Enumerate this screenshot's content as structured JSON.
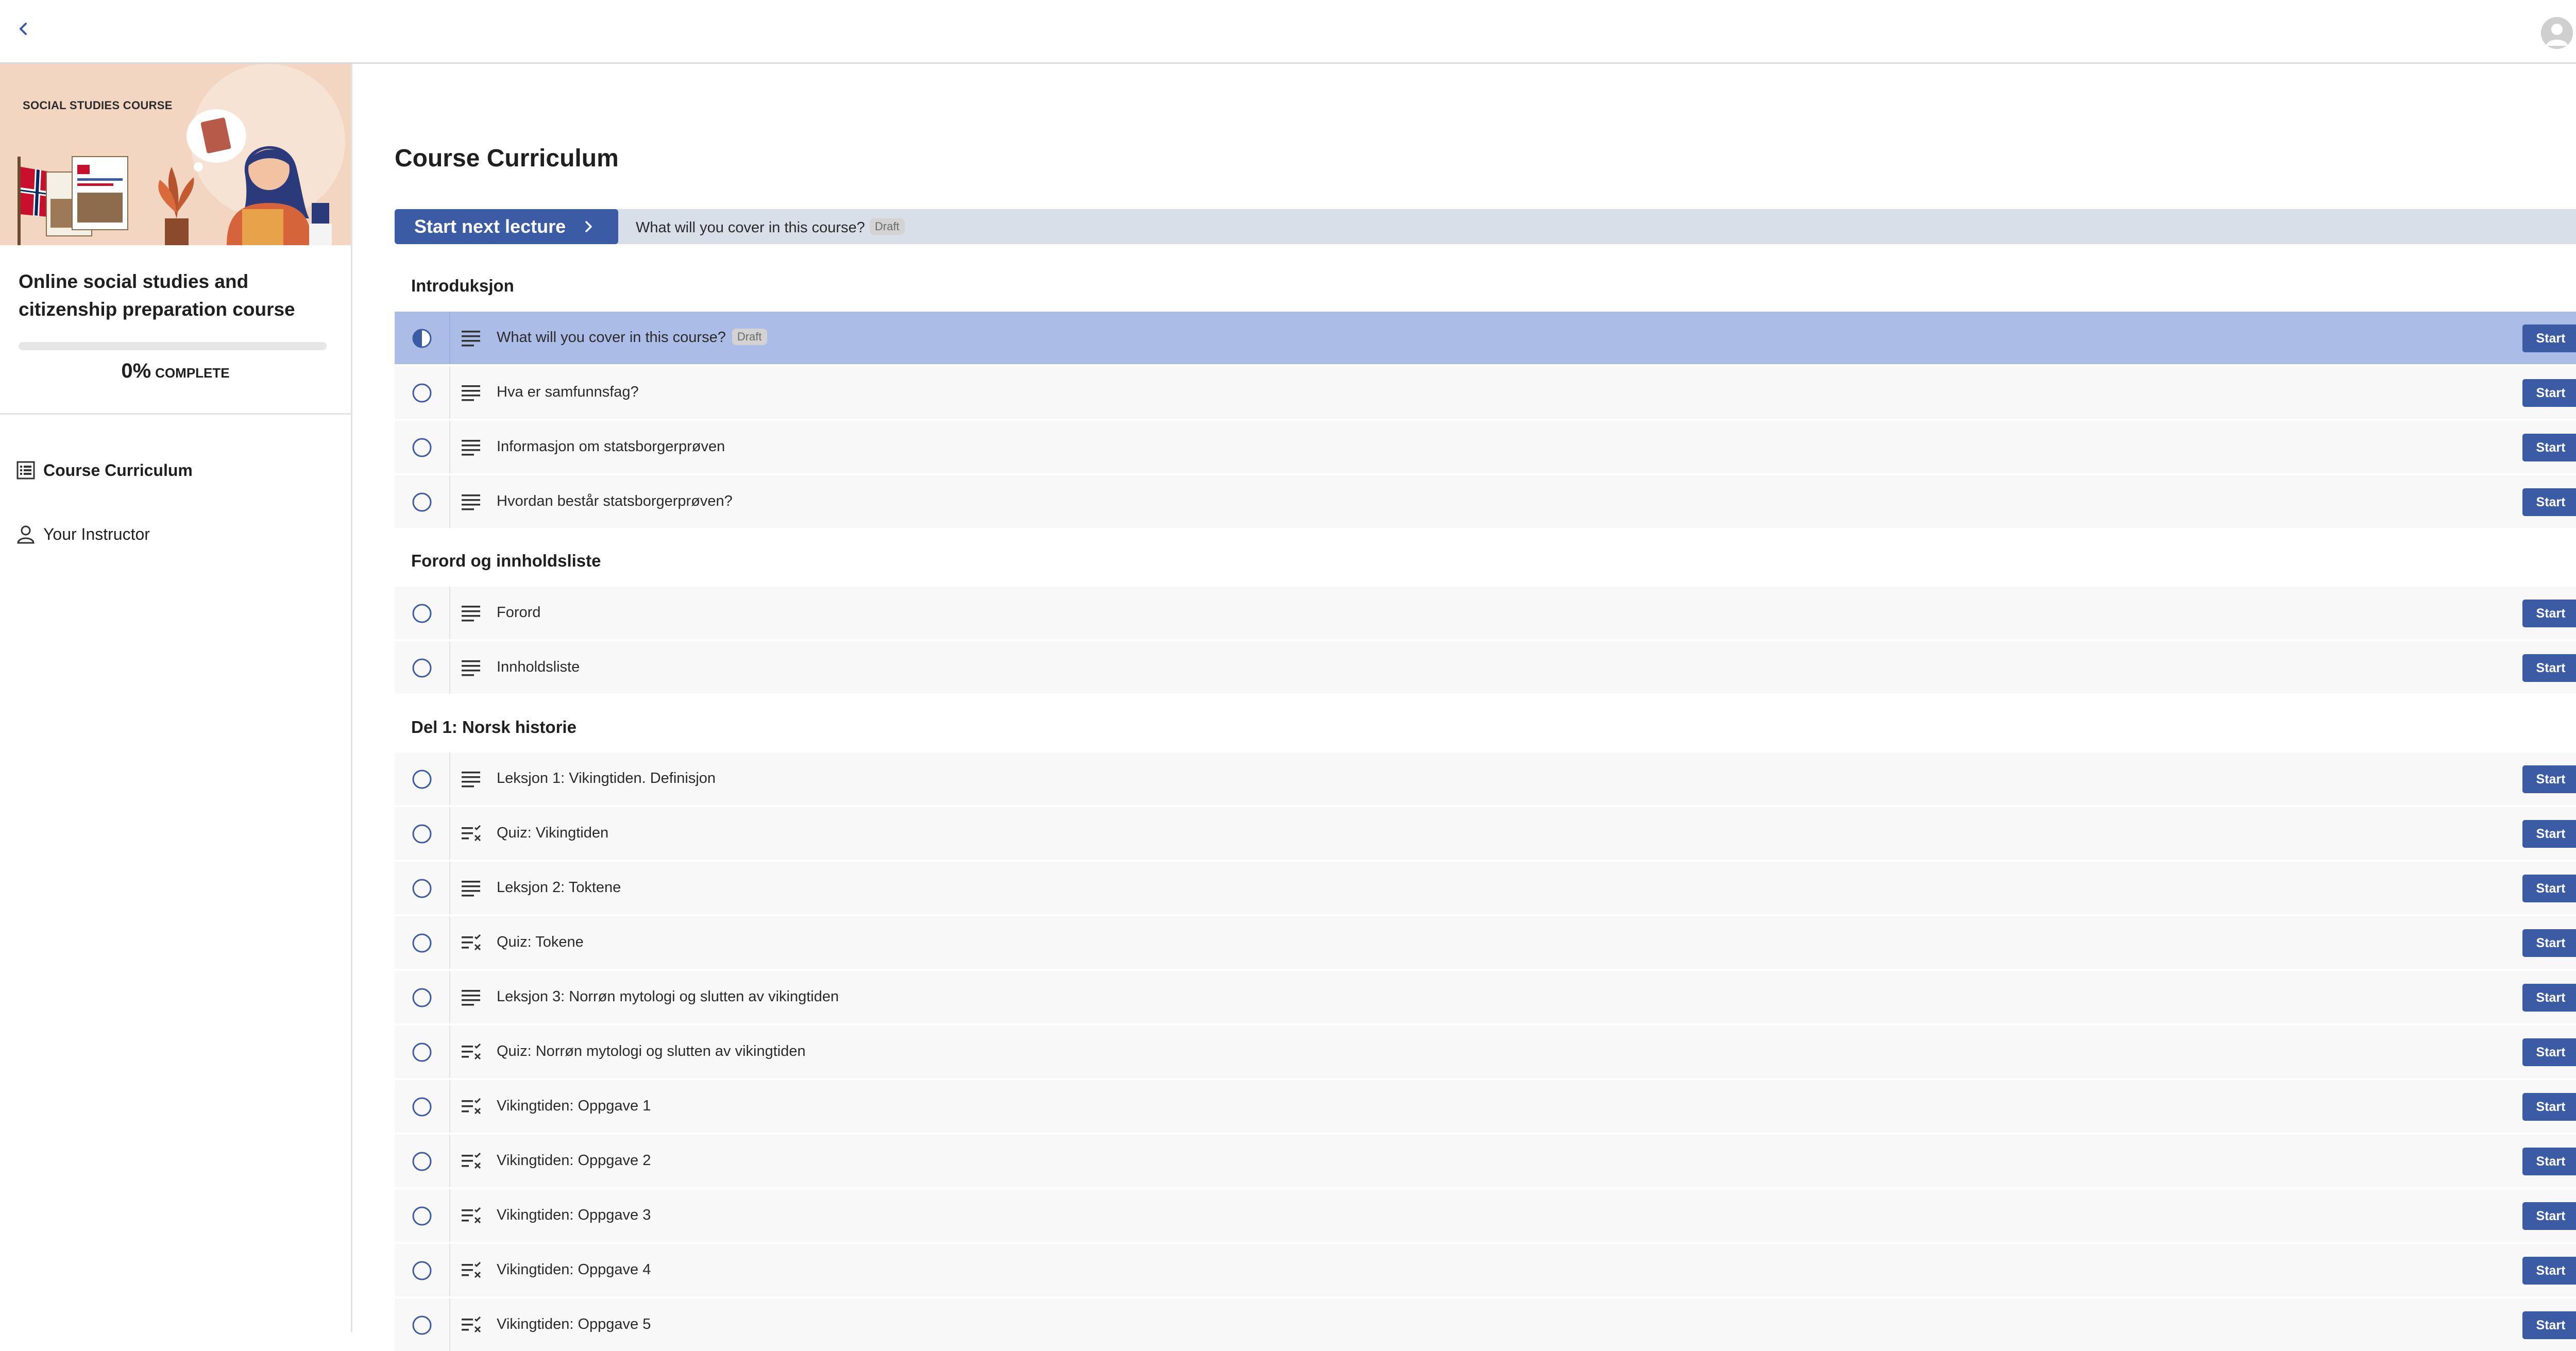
{
  "topbar": {
    "back_icon": "chevron-left-icon",
    "avatar_icon": "user-avatar-icon"
  },
  "sidebar": {
    "image_label": "SOCIAL STUDIES COURSE",
    "course_title": "Online social studies and citizenship preparation course",
    "progress_percent": "0%",
    "progress_value": 0,
    "progress_label": "COMPLETE",
    "nav": [
      {
        "label": "Course Curriculum",
        "icon": "curriculum-list-icon",
        "active": true
      },
      {
        "label": "Your Instructor",
        "icon": "person-icon",
        "active": false
      }
    ]
  },
  "main": {
    "title": "Course Curriculum",
    "next_lecture": {
      "button_label": "Start next lecture",
      "lecture_title": "What will you cover in this course?",
      "badge": "Draft"
    },
    "sections": [
      {
        "title": "Introduksjon",
        "lectures": [
          {
            "title": "What will you cover in this course?",
            "type": "text",
            "badge": "Draft",
            "status": "in-progress",
            "active": true
          },
          {
            "title": "Hva er samfunnsfag?",
            "type": "text",
            "status": "not-started"
          },
          {
            "title": "Informasjon om statsborgerprøven",
            "type": "text",
            "status": "not-started"
          },
          {
            "title": "Hvordan består statsborgerprøven?",
            "type": "text",
            "status": "not-started"
          }
        ]
      },
      {
        "title": "Forord og innholdsliste",
        "lectures": [
          {
            "title": "Forord",
            "type": "text",
            "status": "not-started"
          },
          {
            "title": "Innholdsliste",
            "type": "text",
            "status": "not-started"
          }
        ]
      },
      {
        "title": "Del 1: Norsk historie",
        "lectures": [
          {
            "title": "Leksjon 1: Vikingtiden. Definisjon",
            "type": "text",
            "status": "not-started"
          },
          {
            "title": "Quiz: Vikingtiden",
            "type": "quiz",
            "status": "not-started"
          },
          {
            "title": "Leksjon 2: Toktene",
            "type": "text",
            "status": "not-started"
          },
          {
            "title": "Quiz: Tokene",
            "type": "quiz",
            "status": "not-started"
          },
          {
            "title": "Leksjon 3: Norrøn mytologi og slutten av vikingtiden",
            "type": "text",
            "status": "not-started"
          },
          {
            "title": "Quiz: Norrøn mytologi og slutten av vikingtiden",
            "type": "quiz",
            "status": "not-started"
          },
          {
            "title": "Vikingtiden: Oppgave 1",
            "type": "quiz",
            "status": "not-started"
          },
          {
            "title": "Vikingtiden: Oppgave 2",
            "type": "quiz",
            "status": "not-started"
          },
          {
            "title": "Vikingtiden: Oppgave 3",
            "type": "quiz",
            "status": "not-started"
          },
          {
            "title": "Vikingtiden: Oppgave 4",
            "type": "quiz",
            "status": "not-started"
          },
          {
            "title": "Vikingtiden: Oppgave 5",
            "type": "quiz",
            "status": "not-started"
          }
        ]
      }
    ],
    "start_label": "Start"
  },
  "colors": {
    "accent": "#3b5ba5",
    "active_row": "#abbde6",
    "next_bar": "#d8dfe9"
  }
}
